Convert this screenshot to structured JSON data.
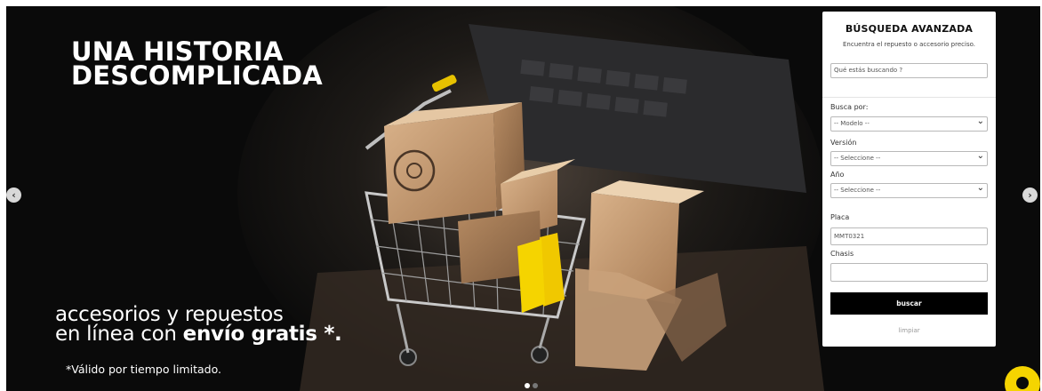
{
  "hero": {
    "headline_line1": "UNA HISTORIA",
    "headline_line2": "DESCOMPLICADA",
    "subline1": "accesorios y repuestos",
    "subline2_prefix": "en línea con ",
    "subline2_bold": "envío gratis *.",
    "note": "*Válido por tiempo limitado.",
    "prev_icon": "chevron-left-icon",
    "next_icon": "chevron-right-icon",
    "slide_count": 2,
    "active_slide": 1
  },
  "search": {
    "title": "BÚSQUEDA AVANZADA",
    "subtitle": "Encuentra el repuesto o accesorio preciso.",
    "query_placeholder": "Qué estás buscando ?",
    "busca_por_label": "Busca por:",
    "modelo_value": "-- Modelo --",
    "version_label": "Versión",
    "version_value": "-- Seleccione --",
    "anio_label": "Año",
    "anio_value": "-- Seleccione --",
    "placa_label": "Placa",
    "placa_placeholder": "MMT0321",
    "chasis_label": "Chasis",
    "chasis_value": "",
    "search_button": "buscar",
    "clear_button": "limpiar"
  },
  "colors": {
    "accent_yellow": "#f5d400",
    "background_dark": "#0a0a0a",
    "button_black": "#000000"
  }
}
